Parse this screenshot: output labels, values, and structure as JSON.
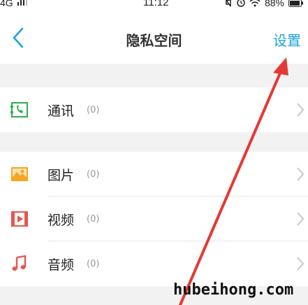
{
  "status_bar": {
    "network": "4G",
    "time": "11:12",
    "battery": "88%",
    "icons": [
      "signal-icon",
      "mute-icon",
      "alarm-icon",
      "wifi-icon",
      "battery-icon"
    ]
  },
  "nav": {
    "title": "隐私空间",
    "settings_label": "设置",
    "back_icon": "chevron-left-icon",
    "accent": "#1aa3d9"
  },
  "items": [
    {
      "label": "通讯",
      "count": "(0)",
      "icon": "contacts-icon",
      "color": "#2bb24c"
    },
    {
      "label": "图片",
      "count": "(0)",
      "icon": "image-icon",
      "color": "#f5a623"
    },
    {
      "label": "视频",
      "count": "(0)",
      "icon": "video-icon",
      "color": "#e8554e"
    },
    {
      "label": "音频",
      "count": "(0)",
      "icon": "music-icon",
      "color": "#e8554e"
    }
  ],
  "annotation": {
    "arrow_color": "#e53935"
  },
  "watermark": "hubeihong.com"
}
